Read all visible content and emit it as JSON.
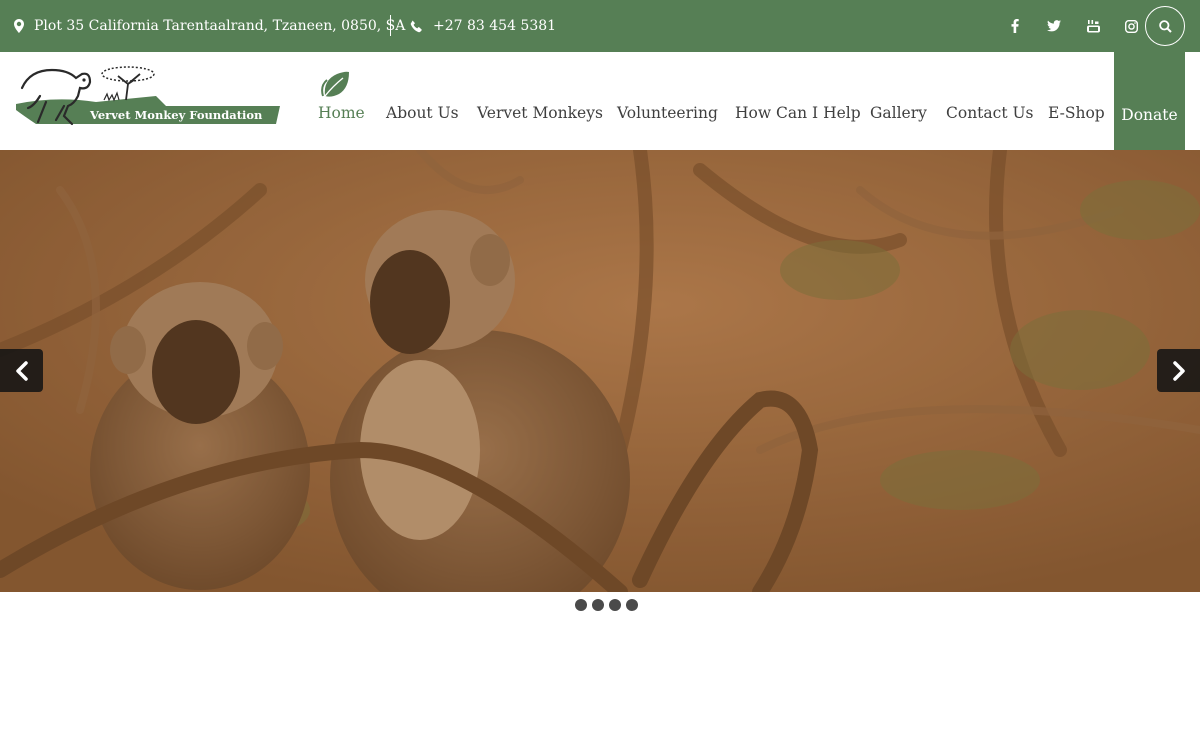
{
  "topbar": {
    "address": "Plot 35 California Tarentaalrand, Tzaneen, 0850, SA",
    "phone": "+27 83 454 5381",
    "social": [
      "facebook-icon",
      "twitter-icon",
      "youtube-icon",
      "instagram-icon"
    ],
    "bg_color": "#567f55"
  },
  "logo": {
    "text": "Vervet Monkey Foundation"
  },
  "nav": {
    "items": [
      "Home",
      "About Us",
      "Vervet Monkeys",
      "Volunteering",
      "How Can I Help",
      "Gallery",
      "Contact Us",
      "E-Shop"
    ],
    "active": "Home",
    "donate": "Donate"
  },
  "slider": {
    "slide_count": 4,
    "prev_icon": "chevron-left-icon",
    "next_icon": "chevron-right-icon"
  },
  "colors": {
    "accent": "#567f55"
  }
}
